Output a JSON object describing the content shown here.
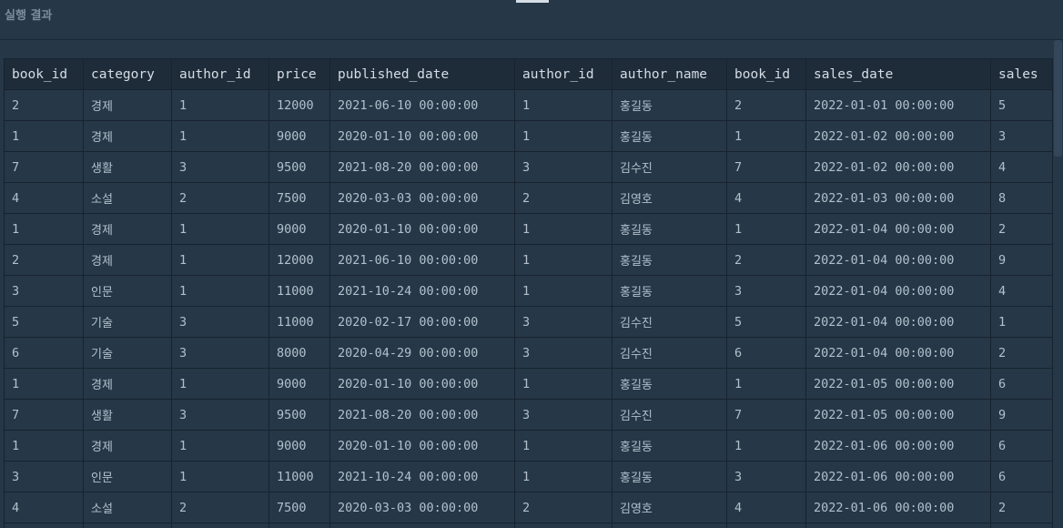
{
  "header": {
    "title": "실행 결과"
  },
  "table": {
    "columns": [
      "book_id",
      "category",
      "author_id",
      "price",
      "published_date",
      "author_id",
      "author_name",
      "book_id",
      "sales_date",
      "sales"
    ],
    "rows": [
      [
        "2",
        "경제",
        "1",
        "12000",
        "2021-06-10 00:00:00",
        "1",
        "홍길동",
        "2",
        "2022-01-01 00:00:00",
        "5"
      ],
      [
        "1",
        "경제",
        "1",
        "9000",
        "2020-01-10 00:00:00",
        "1",
        "홍길동",
        "1",
        "2022-01-02 00:00:00",
        "3"
      ],
      [
        "7",
        "생활",
        "3",
        "9500",
        "2021-08-20 00:00:00",
        "3",
        "김수진",
        "7",
        "2022-01-02 00:00:00",
        "4"
      ],
      [
        "4",
        "소설",
        "2",
        "7500",
        "2020-03-03 00:00:00",
        "2",
        "김영호",
        "4",
        "2022-01-03 00:00:00",
        "8"
      ],
      [
        "1",
        "경제",
        "1",
        "9000",
        "2020-01-10 00:00:00",
        "1",
        "홍길동",
        "1",
        "2022-01-04 00:00:00",
        "2"
      ],
      [
        "2",
        "경제",
        "1",
        "12000",
        "2021-06-10 00:00:00",
        "1",
        "홍길동",
        "2",
        "2022-01-04 00:00:00",
        "9"
      ],
      [
        "3",
        "인문",
        "1",
        "11000",
        "2021-10-24 00:00:00",
        "1",
        "홍길동",
        "3",
        "2022-01-04 00:00:00",
        "4"
      ],
      [
        "5",
        "기술",
        "3",
        "11000",
        "2020-02-17 00:00:00",
        "3",
        "김수진",
        "5",
        "2022-01-04 00:00:00",
        "1"
      ],
      [
        "6",
        "기술",
        "3",
        "8000",
        "2020-04-29 00:00:00",
        "3",
        "김수진",
        "6",
        "2022-01-04 00:00:00",
        "2"
      ],
      [
        "1",
        "경제",
        "1",
        "9000",
        "2020-01-10 00:00:00",
        "1",
        "홍길동",
        "1",
        "2022-01-05 00:00:00",
        "6"
      ],
      [
        "7",
        "생활",
        "3",
        "9500",
        "2021-08-20 00:00:00",
        "3",
        "김수진",
        "7",
        "2022-01-05 00:00:00",
        "9"
      ],
      [
        "1",
        "경제",
        "1",
        "9000",
        "2020-01-10 00:00:00",
        "1",
        "홍길동",
        "1",
        "2022-01-06 00:00:00",
        "6"
      ],
      [
        "3",
        "인문",
        "1",
        "11000",
        "2021-10-24 00:00:00",
        "1",
        "홍길동",
        "3",
        "2022-01-06 00:00:00",
        "6"
      ],
      [
        "4",
        "소설",
        "2",
        "7500",
        "2020-03-03 00:00:00",
        "2",
        "김영호",
        "4",
        "2022-01-06 00:00:00",
        "2"
      ],
      [
        "",
        "",
        "",
        "",
        "",
        "",
        "",
        "",
        "",
        ""
      ]
    ]
  }
}
